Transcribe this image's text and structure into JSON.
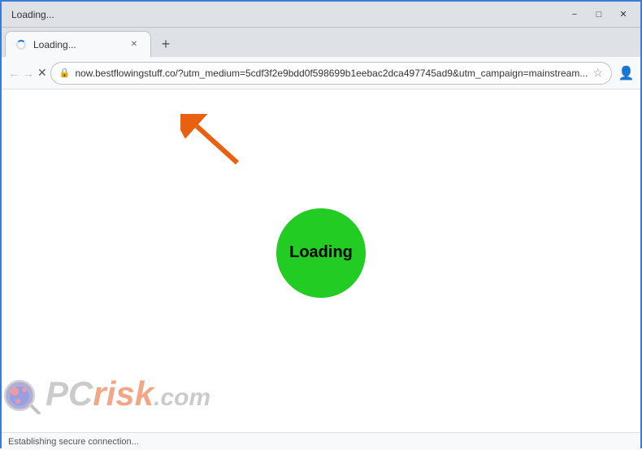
{
  "window": {
    "title": "Loading...",
    "controls": {
      "minimize_label": "−",
      "maximize_label": "□",
      "close_label": "✕"
    }
  },
  "tab": {
    "title": "Loading...",
    "close_label": "✕"
  },
  "new_tab_button": "+",
  "nav": {
    "back_icon": "←",
    "forward_icon": "→",
    "reload_icon": "✕",
    "url": "now.bestflowingstuff.co/?utm_medium=5cdf3f2e9bdd0f598699b1eebac2dca497745ad9&utm_campaign=mainstream...",
    "star_icon": "☆",
    "profile_icon": "○",
    "menu_icon": "⋮"
  },
  "page": {
    "loading_text": "Loading",
    "loading_circle_color": "#22cc22"
  },
  "status_bar": {
    "text": "Establishing secure connection..."
  },
  "watermark": {
    "text_pc": "PC",
    "text_risk": "risk",
    "text_suffix": ".com"
  },
  "arrow": {
    "color": "#e86010",
    "label": "arrow-pointing-up-left"
  }
}
